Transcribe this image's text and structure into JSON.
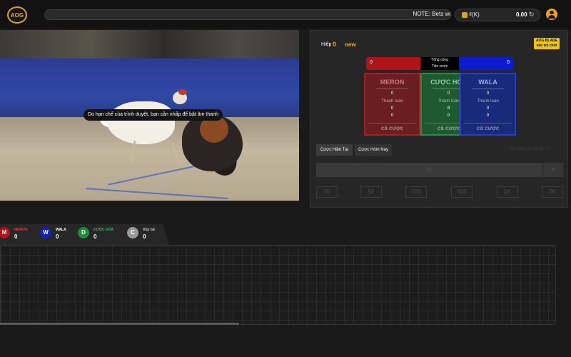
{
  "header": {
    "logo_text": "AOG",
    "note": "NOTE: Bets wi",
    "wallet_currency": "₫(K)",
    "wallet_balance": "0.00",
    "refresh_glyph": "↻"
  },
  "video": {
    "subtitle": "Do hạn chế của trình duyệt, bạn cần nhấp để bật âm thanh"
  },
  "bet_panel": {
    "round_label": "Hiệp",
    "round_value": "0",
    "round_status": "new",
    "badge_lines": [
      "AOG BLADE",
      "vào trò chơi"
    ],
    "total_label_line1": "Tổng cộng",
    "total_label_line2": "Tiền cược",
    "meron_total": "0",
    "wala_total": "0",
    "columns": [
      {
        "title": "MERON",
        "amount": "0",
        "payout_label": "Thanh toán",
        "payout": "0",
        "my_bet": "0",
        "button": "cả cược"
      },
      {
        "title": "CƯỢC HÒA",
        "amount": "0",
        "payout_label": "Thanh toán",
        "payout": "8",
        "my_bet": "0",
        "button": "cả cược"
      },
      {
        "title": "WALA",
        "amount": "0",
        "payout_label": "Thanh toán",
        "payout": "0",
        "my_bet": "0",
        "button": "cả cược"
      }
    ],
    "tabs": [
      "Cược Hiện Tại",
      "Cược Hôm Nay"
    ],
    "hint": "tối thiểu: 20 tối đa: 20",
    "amount_value": "0",
    "clear_label": "✕",
    "chips": [
      "20",
      "50",
      "100",
      "500",
      "1K",
      "2K"
    ]
  },
  "results": {
    "items": [
      {
        "letter": "M",
        "label": "MERON",
        "count": "0",
        "color": "#b0131a",
        "label_color": "#e23a3a"
      },
      {
        "letter": "W",
        "label": "WALA",
        "count": "0",
        "color": "#1420b8",
        "label_color": "#ffffff"
      },
      {
        "letter": "D",
        "label": "CƯỢC HÒA",
        "count": "0",
        "color": "#1f8a3c",
        "label_color": "#3fb35e"
      },
      {
        "letter": "C",
        "label": "Hủy bỏ",
        "count": "0",
        "color": "#9a9a9a",
        "label_color": "#cfcfcf"
      }
    ]
  }
}
